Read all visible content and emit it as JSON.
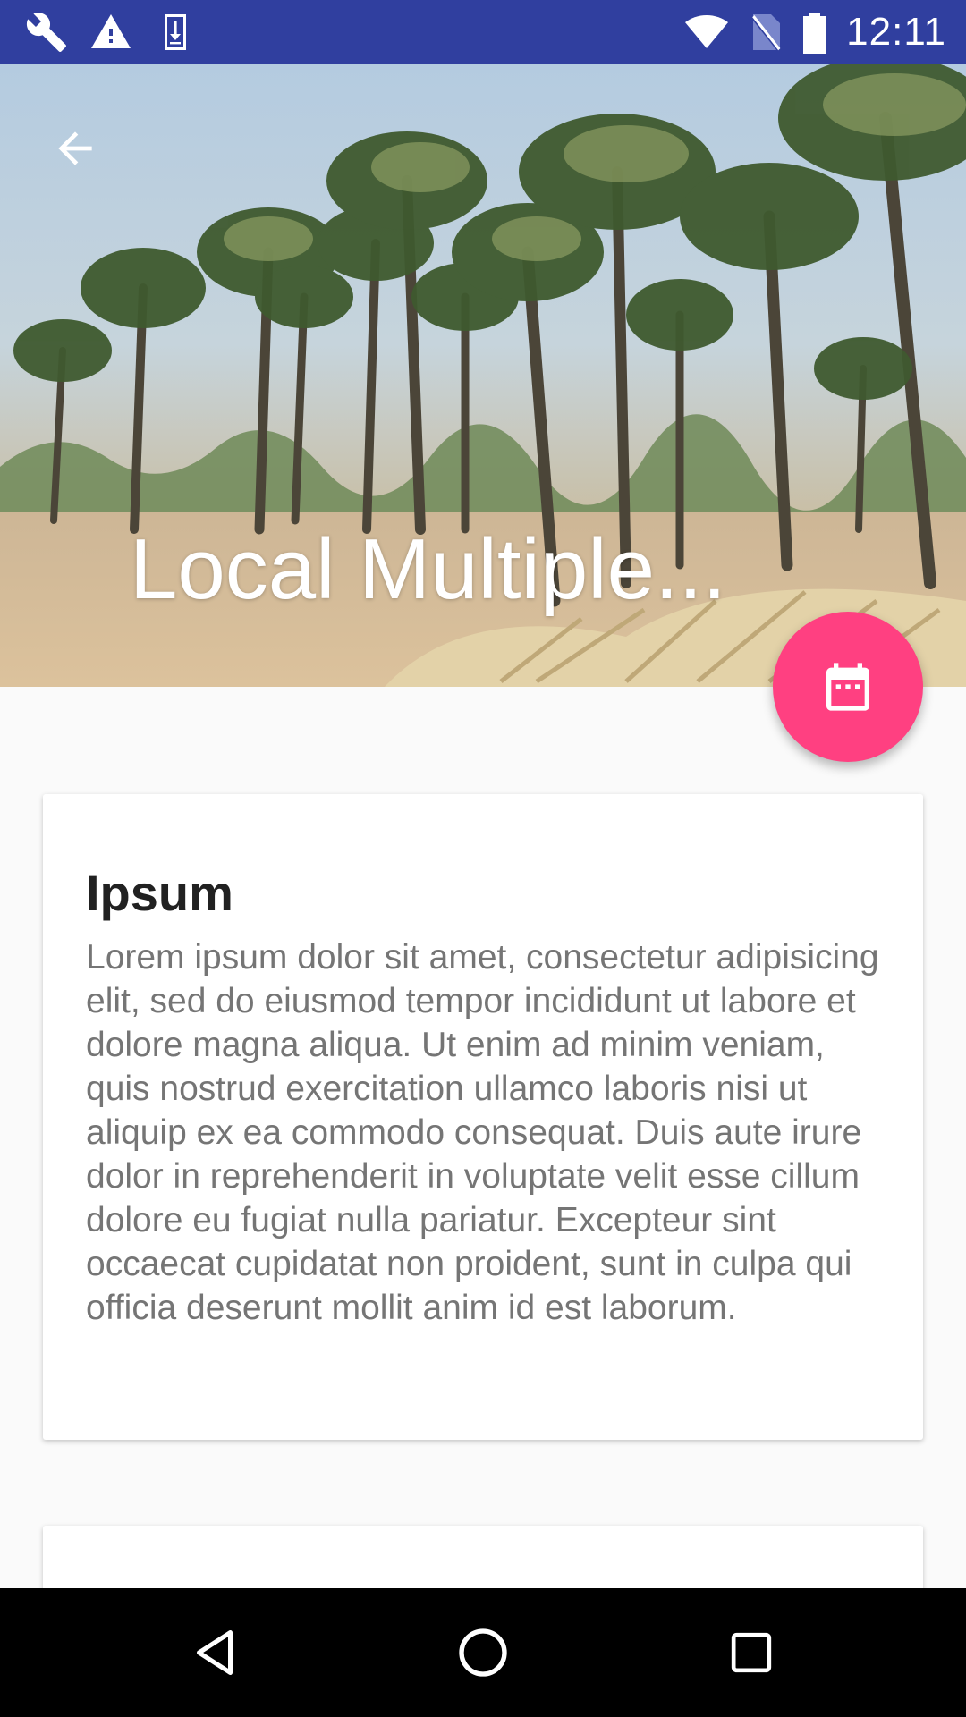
{
  "status_bar": {
    "time": "12:11",
    "left_icons": [
      "wrench-icon",
      "warning-icon",
      "download-icon"
    ],
    "right_icons": [
      "wifi-icon",
      "no-sim-icon",
      "battery-icon"
    ],
    "background": "#303f9f"
  },
  "toolbar": {
    "title": "Local Multiple...",
    "back_icon": "arrow-back-icon"
  },
  "fab": {
    "icon": "calendar-icon",
    "color": "#ff4081"
  },
  "cards": [
    {
      "title": "Ipsum",
      "body": "Lorem ipsum dolor sit amet, consectetur adipisicing elit, sed do eiusmod tempor incididunt ut labore et dolore magna aliqua. Ut enim ad minim veniam, quis nostrud exercitation ullamco laboris nisi ut aliquip ex ea commodo consequat. Duis aute irure dolor in reprehenderit in voluptate velit esse cillum dolore eu fugiat nulla pariatur. Excepteur sint occaecat cupidatat non proident, sunt in culpa qui officia deserunt mollit anim id est laborum."
    }
  ],
  "navigation_bar": {
    "buttons": [
      "back-triangle-icon",
      "home-circle-icon",
      "recents-square-icon"
    ]
  }
}
